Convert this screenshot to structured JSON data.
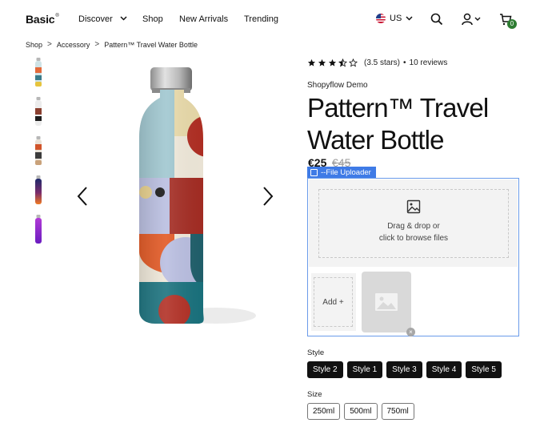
{
  "header": {
    "logo": "Basic",
    "logo_mark": "®",
    "nav": {
      "discover": "Discover",
      "shop": "Shop",
      "new_arrivals": "New Arrivals",
      "trending": "Trending"
    },
    "locale": "US",
    "cart_count": "0"
  },
  "breadcrumb": {
    "items": [
      "Shop",
      "Accessory",
      "Pattern™ Travel Water Bottle"
    ],
    "separator": ">"
  },
  "product": {
    "rating_value": 3.5,
    "rating_text": "(3.5 stars)",
    "bullet": "•",
    "reviews": "10 reviews",
    "vendor": "Shopyflow Demo",
    "title": "Pattern™ Travel Water Bottle",
    "price": "€25",
    "compare_price": "€45"
  },
  "uploader": {
    "tag": "--File Uploader",
    "drop_line1": "Drag & drop or",
    "drop_line2": "click to browse files",
    "add_label": "Add +",
    "remove_label": "×"
  },
  "options": {
    "style_label": "Style",
    "styles": [
      "Style 2",
      "Style 1",
      "Style 3",
      "Style 4",
      "Style 5"
    ],
    "size_label": "Size",
    "sizes": [
      "250ml",
      "500ml",
      "750ml"
    ]
  },
  "colors": {
    "accent_blue": "#3f7be6",
    "badge_green": "#2e7d32",
    "button_dark": "#111111"
  },
  "icons": {
    "search": "search-icon",
    "account": "user-icon",
    "cart": "cart-icon",
    "prev": "chevron-left-icon",
    "next": "chevron-right-icon",
    "image": "image-icon"
  }
}
